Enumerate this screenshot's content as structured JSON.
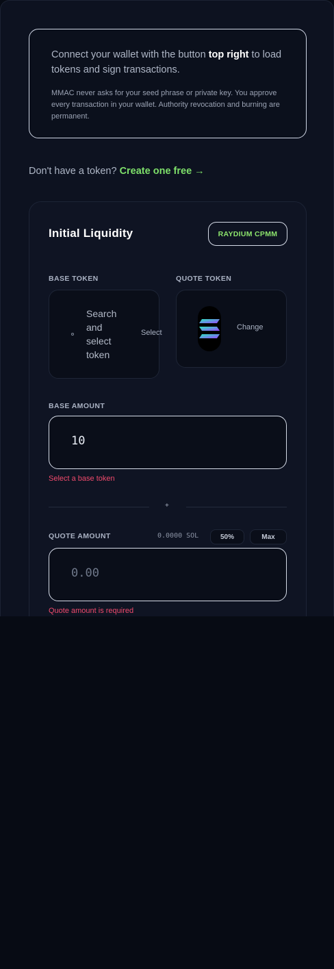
{
  "notice": {
    "line_before": "Connect your wallet with the button ",
    "line_bold": "top right",
    "line_after": " to load tokens and sign transactions.",
    "disclaimer": "MMAC never asks for your seed phrase or private key. You approve every transaction in your wallet. Authority revocation and burning are permanent."
  },
  "create": {
    "prompt": "Don't have a token? ",
    "link": "Create one free →"
  },
  "liquidity": {
    "title": "Initial Liquidity",
    "badge": "RAYDIUM CPMM",
    "base_token_label": "BASE TOKEN",
    "quote_token_label": "QUOTE TOKEN",
    "base_search_text": "Search and select token",
    "base_select": "Select",
    "quote_change": "Change",
    "quote_token_icon": "solana-logo-icon",
    "base_amount_label": "BASE AMOUNT",
    "base_amount_value": "10",
    "base_error": "Select a base token",
    "divider_symbol": "+",
    "quote_amount_label": "QUOTE AMOUNT",
    "quote_balance": "0.0000 SOL",
    "btn_half": "50%",
    "btn_max": "Max",
    "quote_amount_placeholder": "0.00",
    "quote_error": "Quote amount is required"
  },
  "colors": {
    "accent_green": "#7ee06a",
    "error_red": "#ef4a6c",
    "background": "#070b14"
  }
}
